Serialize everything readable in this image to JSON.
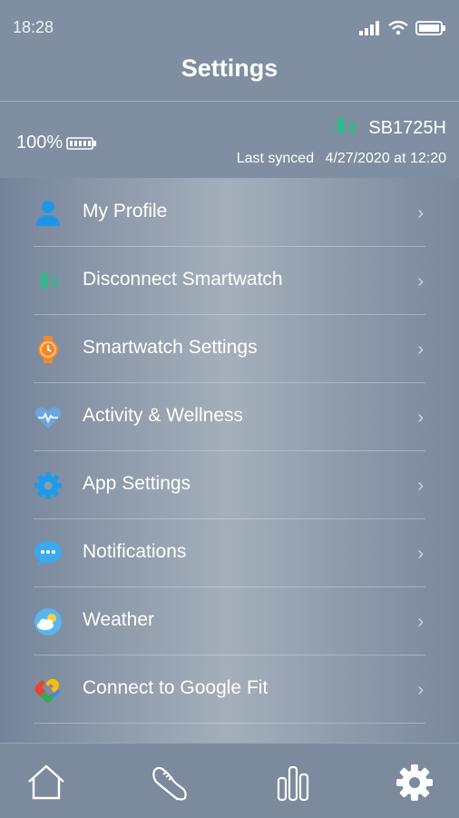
{
  "status_bar": {
    "time": "18:28"
  },
  "header": {
    "title": "Settings"
  },
  "device": {
    "battery_percent": "100%",
    "name": "SB1725H",
    "last_synced_label": "Last synced",
    "last_synced_value": "4/27/2020 at 12:20"
  },
  "menu": [
    {
      "label": "My Profile",
      "icon": "person-icon"
    },
    {
      "label": "Disconnect Smartwatch",
      "icon": "bluetooth-icon"
    },
    {
      "label": "Smartwatch Settings",
      "icon": "watch-icon"
    },
    {
      "label": "Activity & Wellness",
      "icon": "heart-pulse-icon"
    },
    {
      "label": "App Settings",
      "icon": "gear-icon"
    },
    {
      "label": "Notifications",
      "icon": "chat-bubble-icon"
    },
    {
      "label": "Weather",
      "icon": "weather-icon"
    },
    {
      "label": "Connect to Google Fit",
      "icon": "google-fit-icon"
    }
  ],
  "bottom_nav": [
    {
      "name": "home",
      "icon": "home-icon"
    },
    {
      "name": "activity",
      "icon": "shoe-icon"
    },
    {
      "name": "stats",
      "icon": "bar-chart-icon"
    },
    {
      "name": "settings",
      "icon": "gear-icon",
      "active": true
    }
  ],
  "colors": {
    "profile": "#1e96e8",
    "bluetooth": "#24c08a",
    "watch": "#f08a2a",
    "heart": "#6aa6e0",
    "gear": "#1e9be8",
    "notifications": "#3aa9ee"
  }
}
